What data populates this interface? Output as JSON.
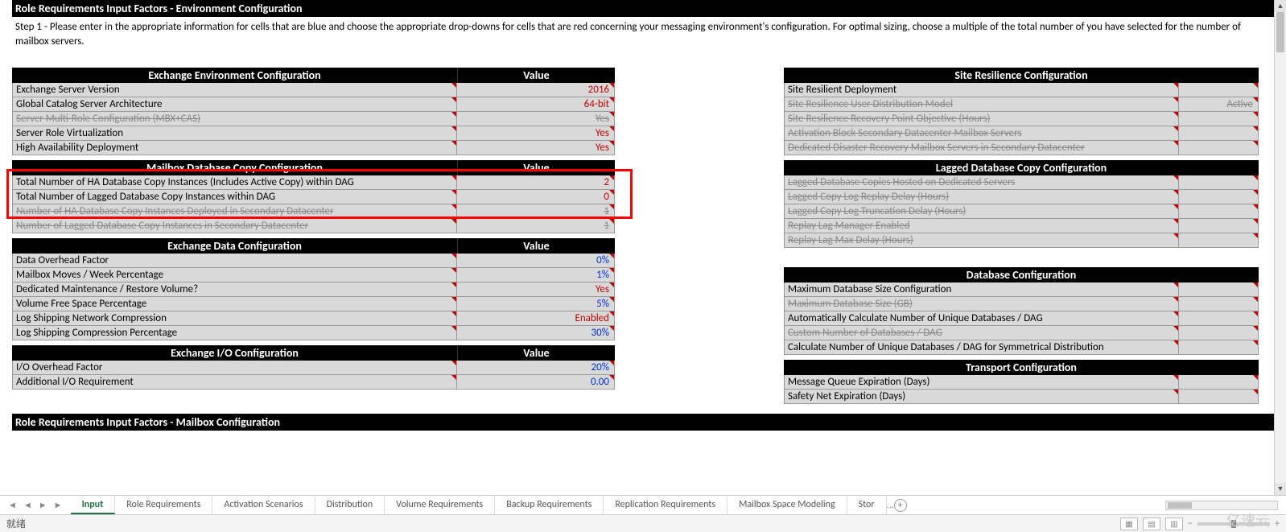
{
  "title_bar1": "Role Requirements Input Factors - Environment Configuration",
  "intro": "Step 1 - Please enter in the appropriate information for cells that are blue and choose the appropriate drop-downs for cells that are red concerning your messaging environment's configuration.  For optimal sizing, choose a multiple of the total number of you have selected for the number of mailbox servers.",
  "title_bar2": "Role Requirements Input Factors - Mailbox Configuration",
  "headers": {
    "value": "Value"
  },
  "left": {
    "env": {
      "title": "Exchange Environment Configuration",
      "rows": [
        {
          "label": "Exchange Server Version",
          "value": "2016",
          "cls": "red"
        },
        {
          "label": "Global Catalog Server Architecture",
          "value": "64-bit",
          "cls": "red"
        },
        {
          "label": "Server Multi-Role Configuration (MBX+CAS)",
          "value": "Yes",
          "cls": "red",
          "strike": true
        },
        {
          "label": "Server Role Virtualization",
          "value": "Yes",
          "cls": "red"
        },
        {
          "label": "High Availability Deployment",
          "value": "Yes",
          "cls": "red"
        }
      ]
    },
    "mdbc": {
      "title": "Mailbox Database Copy Configuration",
      "rows": [
        {
          "label": "Total Number of HA Database Copy Instances (Includes Active Copy) within DAG",
          "value": "2",
          "cls": "red"
        },
        {
          "label": "Total Number of Lagged Database Copy Instances within DAG",
          "value": "0",
          "cls": "red"
        },
        {
          "label": "Number of HA Database Copy Instances Deployed in Secondary Datacenter",
          "value": "1",
          "cls": "blue",
          "strike": true
        },
        {
          "label": "Number of Lagged Database Copy Instances in Secondary Datacenter",
          "value": "1",
          "cls": "blue",
          "strike": true
        }
      ]
    },
    "edc": {
      "title": "Exchange Data Configuration",
      "rows": [
        {
          "label": "Data Overhead Factor",
          "value": "0%",
          "cls": "blue"
        },
        {
          "label": "Mailbox Moves / Week Percentage",
          "value": "1%",
          "cls": "blue"
        },
        {
          "label": "Dedicated Maintenance / Restore Volume?",
          "value": "Yes",
          "cls": "red"
        },
        {
          "label": "Volume Free Space Percentage",
          "value": "5%",
          "cls": "blue"
        },
        {
          "label": "Log Shipping Network Compression",
          "value": "Enabled",
          "cls": "red"
        },
        {
          "label": "Log Shipping Compression Percentage",
          "value": "30%",
          "cls": "blue"
        }
      ]
    },
    "eio": {
      "title": "Exchange I/O Configuration",
      "rows": [
        {
          "label": "I/O Overhead Factor",
          "value": "20%",
          "cls": "blue"
        },
        {
          "label": "Additional I/O Requirement",
          "value": "0.00",
          "cls": "blue"
        }
      ]
    }
  },
  "right": {
    "src": {
      "title": "Site Resilience Configuration",
      "rows": [
        {
          "label": "Site Resilient Deployment",
          "value": "",
          "cls": "black"
        },
        {
          "label": "Site Resilience User Distribution Model",
          "value": "Active",
          "cls": "black",
          "strike": true
        },
        {
          "label": "Site Resilience Recovery Point Objective (Hours)",
          "value": "",
          "cls": "black",
          "strike": true
        },
        {
          "label": "Activation Block Secondary Datacenter Mailbox Servers",
          "value": "",
          "cls": "black",
          "strike": true
        },
        {
          "label": "Dedicated Disaster Recovery Mailbox Servers in Secondary Datacenter",
          "value": "",
          "cls": "black",
          "strike": true
        }
      ]
    },
    "ldbc": {
      "title": "Lagged Database Copy Configuration",
      "rows": [
        {
          "label": "Lagged Database Copies Hosted on Dedicated Servers",
          "value": "",
          "cls": "black",
          "strike": true
        },
        {
          "label": "Lagged Copy Log Replay Delay (Hours)",
          "value": "",
          "cls": "black",
          "strike": true
        },
        {
          "label": "Lagged Copy Log Truncation Delay (Hours)",
          "value": "",
          "cls": "black",
          "strike": true
        },
        {
          "label": "Replay Lag Manager Enabled",
          "value": "",
          "cls": "black",
          "strike": true
        },
        {
          "label": "Replay Lag Max Delay (Hours)",
          "value": "",
          "cls": "black",
          "strike": true
        }
      ]
    },
    "dbc": {
      "title": "Database Configuration",
      "rows": [
        {
          "label": "Maximum Database Size Configuration",
          "value": "",
          "cls": "black"
        },
        {
          "label": "Maximum Database Size (GB)",
          "value": "",
          "cls": "black",
          "strike": true
        },
        {
          "label": "Automatically Calculate Number of Unique Databases / DAG",
          "value": "",
          "cls": "black"
        },
        {
          "label": "Custom Number of Databases / DAG",
          "value": "",
          "cls": "black",
          "strike": true
        },
        {
          "label": "Calculate Number of Unique Databases / DAG for Symmetrical Distribution",
          "value": "",
          "cls": "black"
        }
      ]
    },
    "tc": {
      "title": "Transport Configuration",
      "rows": [
        {
          "label": "Message Queue Expiration (Days)",
          "value": "",
          "cls": "black"
        },
        {
          "label": "Safety Net Expiration (Days)",
          "value": "",
          "cls": "black"
        }
      ]
    }
  },
  "tabs": [
    "Input",
    "Role Requirements",
    "Activation Scenarios",
    "Distribution",
    "Volume Requirements",
    "Backup Requirements",
    "Replication Requirements",
    "Mailbox Space Modeling",
    "Stor"
  ],
  "tabs_more": "...",
  "status": {
    "ready": "就绪",
    "watermark": "亿速云"
  }
}
